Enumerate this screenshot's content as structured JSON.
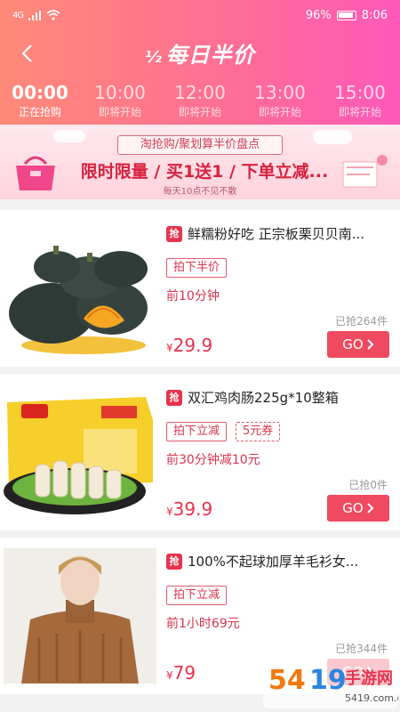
{
  "status": {
    "net": "4G",
    "battery": "96%",
    "time": "8:06"
  },
  "header": {
    "title": "每日半价"
  },
  "time_tabs": [
    {
      "time": "00:00",
      "status": "正在抢购",
      "active": true
    },
    {
      "time": "10:00",
      "status": "即将开始",
      "active": false
    },
    {
      "time": "12:00",
      "status": "即将开始",
      "active": false
    },
    {
      "time": "13:00",
      "status": "即将开始",
      "active": false
    },
    {
      "time": "15:00",
      "status": "即将开始",
      "active": false
    }
  ],
  "banner": {
    "top": "淘抢购/聚划算半价盘点",
    "main": "限时限量 / 买1送1 / 下单立减...",
    "sub": "每天10点不见不散"
  },
  "items": [
    {
      "badge": "抢",
      "name": "鲜糯粉好吃 正宗板栗贝贝南...",
      "tags": [
        "拍下半价"
      ],
      "desc": "前10分钟",
      "sold": "已抢264件",
      "currency": "¥",
      "price": "29.9",
      "go": "GO"
    },
    {
      "badge": "抢",
      "name": "双汇鸡肉肠225g*10整箱",
      "tags": [
        "拍下立减",
        "5元券"
      ],
      "desc": "前30分钟减10元",
      "sold": "已抢0件",
      "currency": "¥",
      "price": "39.9",
      "go": "GO"
    },
    {
      "badge": "抢",
      "name": "100%不起球加厚羊毛衫女...",
      "tags": [
        "拍下立减"
      ],
      "desc": "前1小时69元",
      "sold": "已抢344件",
      "currency": "¥",
      "price": "79",
      "go": "GO"
    }
  ],
  "watermark": {
    "text": "541手游网",
    "url": "5419.com.cn"
  },
  "colors": {
    "accent": "#e8334c",
    "header_start": "#ff8a78",
    "header_end": "#ff58b9"
  }
}
